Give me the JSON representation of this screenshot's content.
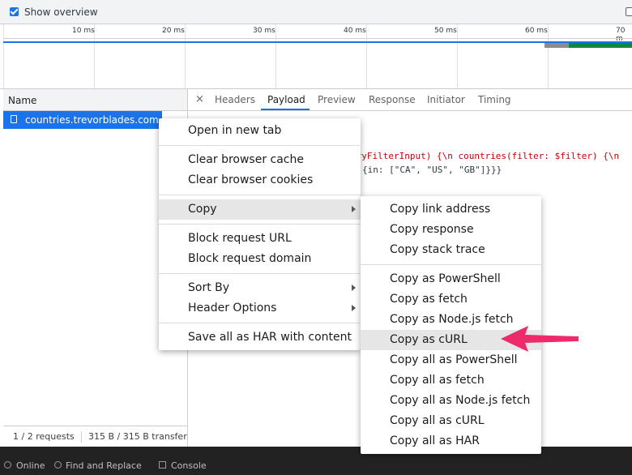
{
  "overview": {
    "checkbox_label": "Show overview",
    "checked": true
  },
  "timeline": {
    "ticks": [
      "10 ms",
      "20 ms",
      "30 ms",
      "40 ms",
      "50 ms",
      "60 ms",
      "70 m"
    ],
    "colors": {
      "blue": "#1a73e8",
      "waiting": "#8c8c8c",
      "download": "#0a8a3e"
    }
  },
  "requests": {
    "column_header": "Name",
    "rows": [
      {
        "name": "countries.trevorblades.com",
        "selected": true
      }
    ],
    "status": {
      "requests": "1 / 2 requests",
      "transfer": "315 B / 315 B transfer"
    }
  },
  "details": {
    "close": "×",
    "tabs": [
      {
        "label": "Headers"
      },
      {
        "label": "Payload",
        "active": true
      },
      {
        "label": "Preview"
      },
      {
        "label": "Response"
      },
      {
        "label": "Initiator"
      },
      {
        "label": "Timing"
      }
    ],
    "payload_line_1": "tryFilterInput) {\\n  countries(filter: $filter) {\\n",
    "payload_line_2": "{in: [\"CA\", \"US\", \"GB\"]}}}"
  },
  "context_menu": {
    "open_new_tab": "Open in new tab",
    "clear_cache": "Clear browser cache",
    "clear_cookies": "Clear browser cookies",
    "copy": "Copy",
    "block_url": "Block request URL",
    "block_domain": "Block request domain",
    "sort_by": "Sort By",
    "header_options": "Header Options",
    "save_har": "Save all as HAR with content"
  },
  "copy_submenu": {
    "items": [
      "Copy link address",
      "Copy response",
      "Copy stack trace",
      "Copy as PowerShell",
      "Copy as fetch",
      "Copy as Node.js fetch",
      "Copy as cURL",
      "Copy all as PowerShell",
      "Copy all as fetch",
      "Copy all as Node.js fetch",
      "Copy all as cURL",
      "Copy all as HAR"
    ],
    "highlighted": "Copy as cURL"
  },
  "drawer": {
    "online": "Online",
    "find_replace": "Find and Replace",
    "console": "Console"
  },
  "annotation": {
    "arrow_color": "#ee2a6b"
  }
}
